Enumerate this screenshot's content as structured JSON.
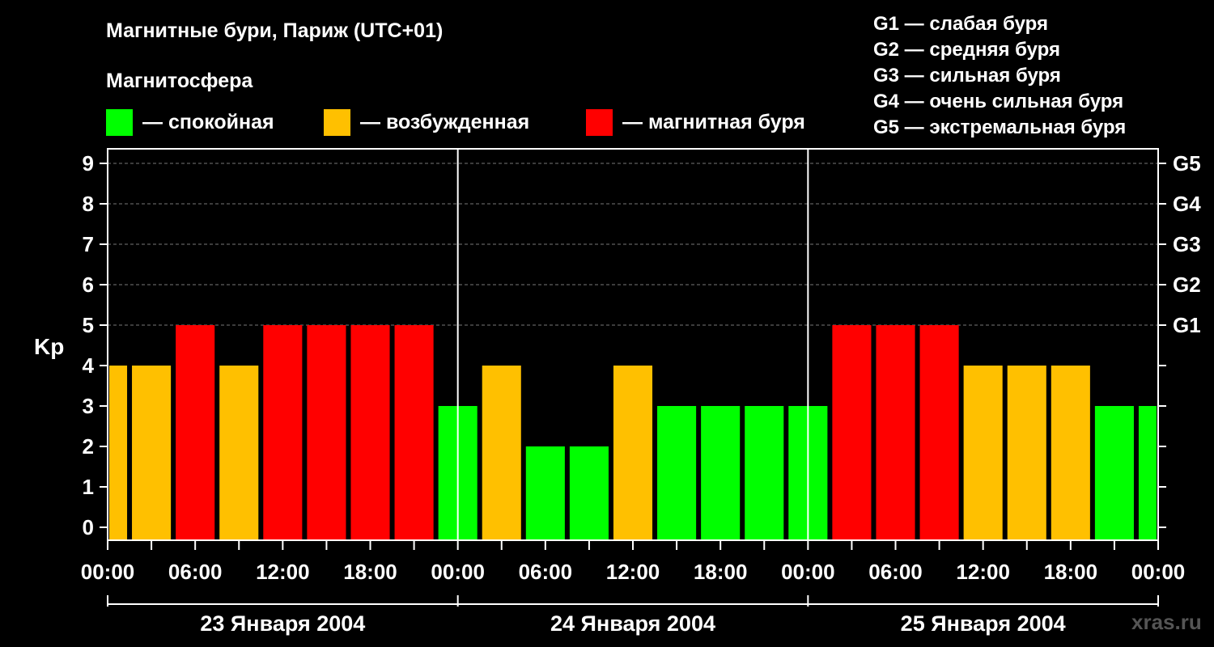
{
  "header": {
    "title": "Магнитные бури, Париж (UTC+01)",
    "subtitle": "Магнитосфера"
  },
  "legend": {
    "items": [
      {
        "label": "— спокойная",
        "color": "#00ff00"
      },
      {
        "label": "— возбужденная",
        "color": "#ffc000"
      },
      {
        "label": "— магнитная буря",
        "color": "#ff0000"
      }
    ]
  },
  "g_legend": [
    "G1 — слабая буря",
    "G2 — средняя буря",
    "G3 — сильная буря",
    "G4 — очень сильная буря",
    "G5 — экстремальная буря"
  ],
  "watermark": "xras.ru",
  "chart_data": {
    "type": "bar",
    "ylabel": "Kp",
    "ylim": [
      0,
      9
    ],
    "yticks": [
      "0",
      "1",
      "2",
      "3",
      "4",
      "5",
      "6",
      "7",
      "8",
      "9"
    ],
    "right_ticks": [
      {
        "value": 5,
        "label": "G1"
      },
      {
        "value": 6,
        "label": "G2"
      },
      {
        "value": 7,
        "label": "G3"
      },
      {
        "value": 8,
        "label": "G4"
      },
      {
        "value": 9,
        "label": "G5"
      }
    ],
    "grid_values": [
      5,
      6,
      7,
      8,
      9
    ],
    "xtick_labels": [
      "00:00",
      "06:00",
      "12:00",
      "18:00",
      "00:00",
      "06:00",
      "12:00",
      "18:00",
      "00:00",
      "06:00",
      "12:00",
      "18:00",
      "00:00"
    ],
    "days": [
      "23 Января 2004",
      "24 Января 2004",
      "25 Января 2004"
    ],
    "bar_interval_hours": 3,
    "colors": {
      "quiet": "#00ff00",
      "active": "#ffc000",
      "storm": "#ff0000"
    },
    "values": [
      4,
      4,
      5,
      4,
      5,
      5,
      5,
      5,
      3,
      4,
      2,
      2,
      4,
      3,
      3,
      3,
      3,
      5,
      5,
      5,
      4,
      4,
      4,
      3,
      3
    ],
    "levels": [
      "active",
      "active",
      "storm",
      "active",
      "storm",
      "storm",
      "storm",
      "storm",
      "quiet",
      "active",
      "quiet",
      "quiet",
      "active",
      "quiet",
      "quiet",
      "quiet",
      "quiet",
      "storm",
      "storm",
      "storm",
      "active",
      "active",
      "active",
      "quiet",
      "quiet"
    ]
  }
}
